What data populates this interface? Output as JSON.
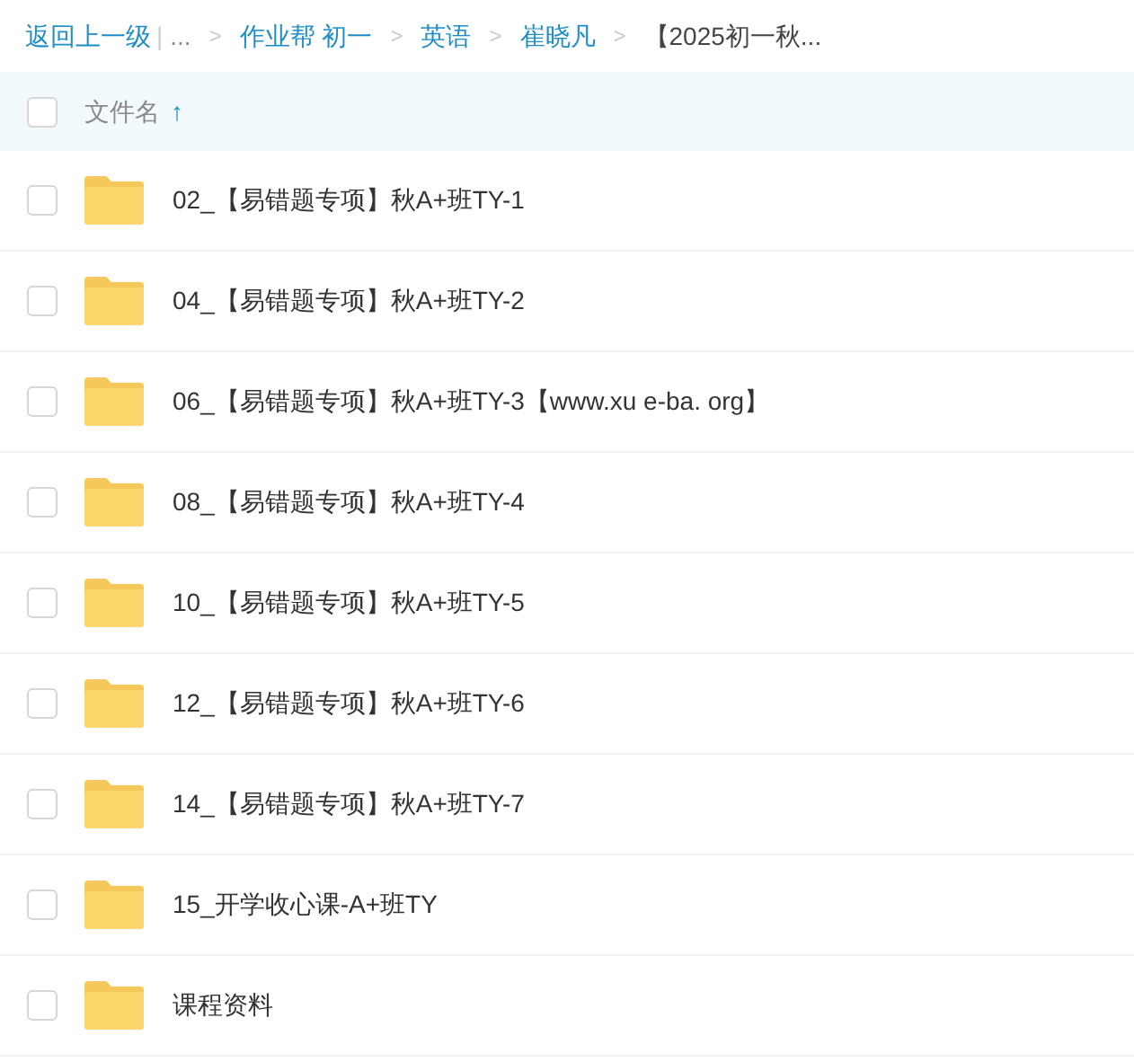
{
  "breadcrumb": {
    "back": "返回上一级",
    "separator": "|",
    "ellipsis": "...",
    "items": [
      {
        "label": "作业帮 初一",
        "current": false
      },
      {
        "label": "英语",
        "current": false
      },
      {
        "label": "崔晓凡",
        "current": false
      },
      {
        "label": "【2025初一秋...",
        "current": true
      }
    ],
    "chevron": ">"
  },
  "header": {
    "checked": false,
    "column": "文件名",
    "sort_arrow": "↑"
  },
  "files": [
    {
      "name": "02_【易错题专项】秋A+班TY-1",
      "checked": false
    },
    {
      "name": "04_【易错题专项】秋A+班TY-2",
      "checked": false
    },
    {
      "name": "06_【易错题专项】秋A+班TY-3【www.xu e-ba. org】",
      "checked": false
    },
    {
      "name": "08_【易错题专项】秋A+班TY-4",
      "checked": false
    },
    {
      "name": "10_【易错题专项】秋A+班TY-5",
      "checked": false
    },
    {
      "name": "12_【易错题专项】秋A+班TY-6",
      "checked": false
    },
    {
      "name": "14_【易错题专项】秋A+班TY-7",
      "checked": false
    },
    {
      "name": "15_开学收心课-A+班TY",
      "checked": false
    },
    {
      "name": "课程资料",
      "checked": false
    }
  ]
}
